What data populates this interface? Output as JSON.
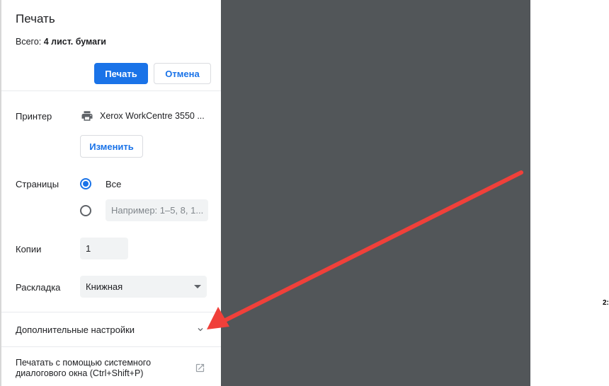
{
  "dialog": {
    "title": "Печать",
    "total_prefix": "Всего: ",
    "total_value": "4 лист. бумаги",
    "print_label": "Печать",
    "cancel_label": "Отмена"
  },
  "printer": {
    "label": "Принтер",
    "name": "Xerox WorkCentre 3550 ...",
    "change_label": "Изменить"
  },
  "pages": {
    "label": "Страницы",
    "all_label": "Все",
    "custom_placeholder": "Например: 1–5, 8, 1..."
  },
  "copies": {
    "label": "Копии",
    "value": "1"
  },
  "layout": {
    "label": "Раскладка",
    "selected": "Книжная"
  },
  "more_settings": {
    "label": "Дополнительные настройки"
  },
  "system_dialog": {
    "line1": "Печатать с помощью системного",
    "line2": "диалогового окна (Ctrl+Shift+P)"
  },
  "preview": {
    "page_text": "2:"
  },
  "colors": {
    "accent": "#1a73e8",
    "preview_bg": "#525659",
    "annotation_arrow": "#f0403a"
  },
  "icons": [
    "printer-icon",
    "chevron-down-icon",
    "external-link-icon",
    "arrow-annotation"
  ]
}
